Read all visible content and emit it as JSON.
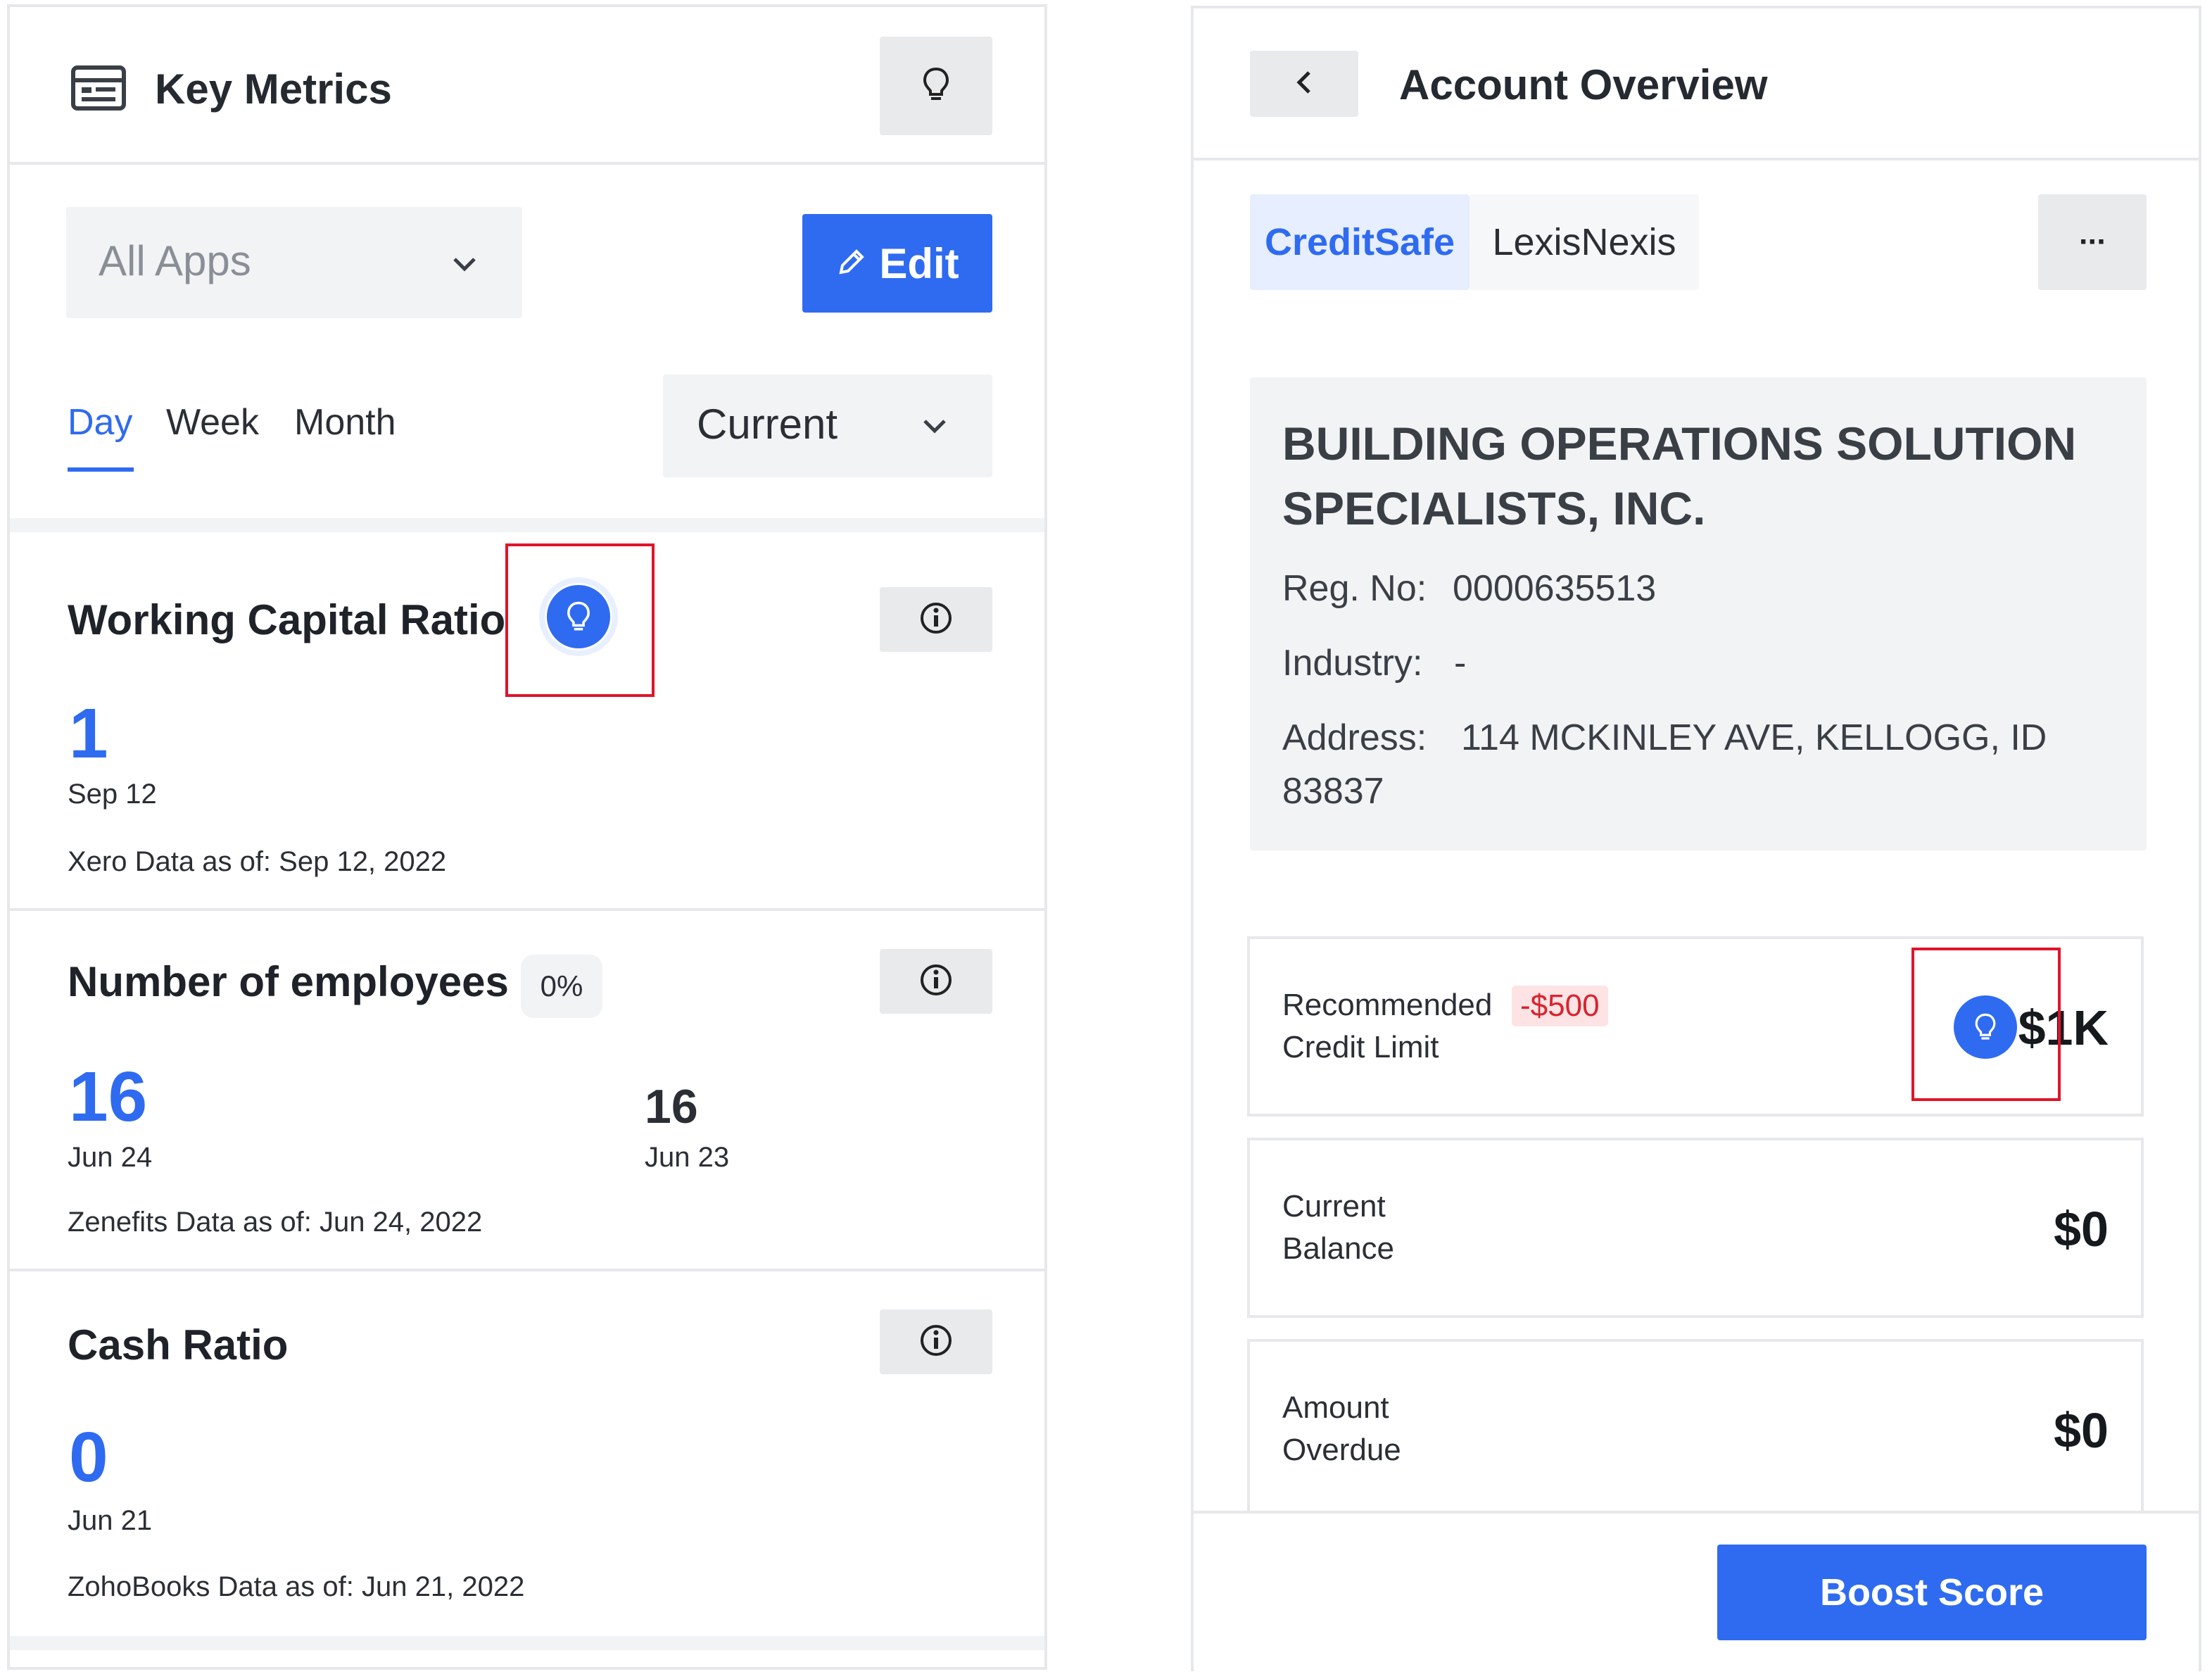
{
  "key_metrics": {
    "title": "Key Metrics",
    "apps_filter": "All Apps",
    "edit_label": "Edit",
    "periods": [
      "Day",
      "Week",
      "Month"
    ],
    "period_selected": "Day",
    "current_filter": "Current",
    "metrics": [
      {
        "title": "Working Capital Ratio",
        "value": "1",
        "date": "Sep 12",
        "source": "Xero Data as of: Sep 12, 2022"
      },
      {
        "title": "Number of employees",
        "change": "0%",
        "value": "16",
        "date": "Jun 24",
        "prev_value": "16",
        "prev_date": "Jun 23",
        "source": "Zenefits Data as of: Jun 24, 2022"
      },
      {
        "title": "Cash Ratio",
        "value": "0",
        "date": "Jun 21",
        "source": "ZohoBooks Data as of: Jun 21, 2022"
      }
    ]
  },
  "account_overview": {
    "title": "Account Overview",
    "tabs": [
      "CreditSafe",
      "LexisNexis"
    ],
    "active_tab": "CreditSafe",
    "more_label": "···",
    "company": {
      "name_line1": "BUILDING OPERATIONS SOLUTION",
      "name_line2": "SPECIALISTS, INC.",
      "reg_label": "Reg. No:",
      "reg_no": "0000635513",
      "industry_label": "Industry:",
      "industry": "-",
      "address_label": "Address:",
      "address_line1": "114 MCKINLEY AVE, KELLOGG, ID",
      "address_line2": "83837"
    },
    "cards": [
      {
        "label_line1": "Recommended",
        "label_line2": "Credit Limit",
        "badge": "-$500",
        "value": "$1K"
      },
      {
        "label_line1": "Current",
        "label_line2": "Balance",
        "value": "$0"
      },
      {
        "label_line1": "Amount",
        "label_line2": "Overdue",
        "value": "$0"
      }
    ],
    "boost_label": "Boost Score"
  },
  "colors": {
    "accent": "#2f6bf0",
    "danger": "#d9232e",
    "highlight": "#e0142b"
  }
}
